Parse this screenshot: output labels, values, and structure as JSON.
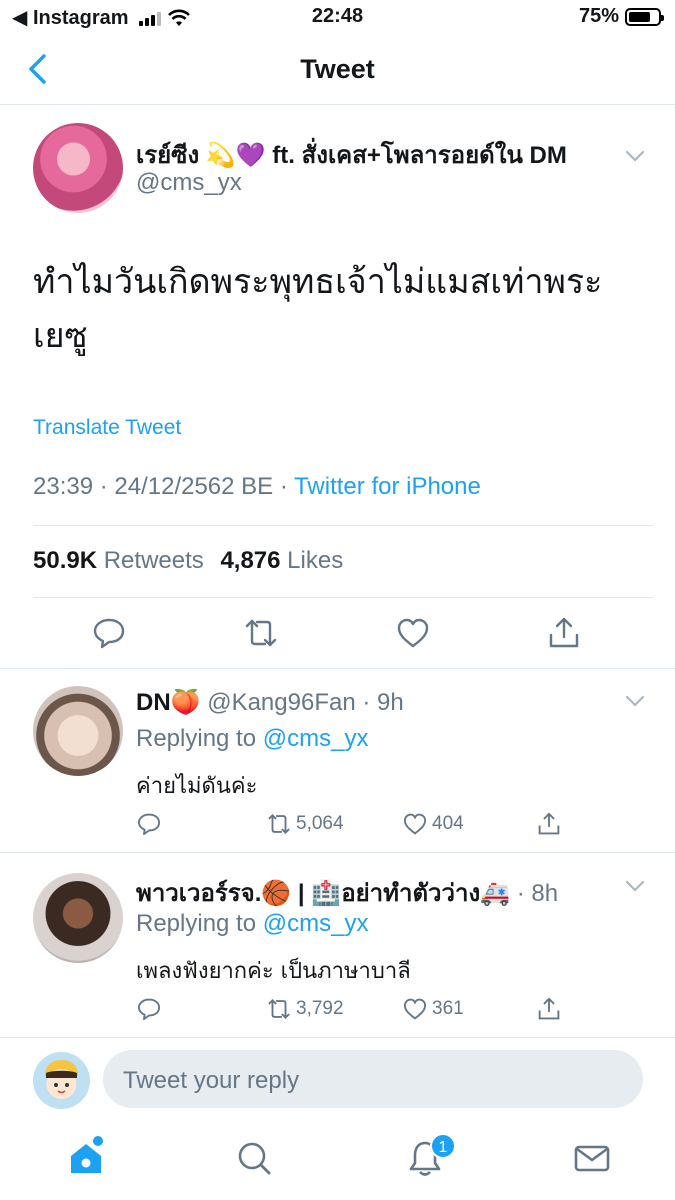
{
  "status": {
    "back_app": "◀ Instagram",
    "time": "22:48",
    "battery": "75%",
    "battery_fraction": 0.75
  },
  "nav": {
    "title": "Tweet"
  },
  "tweet": {
    "name": "เรย์ซีง 💫💜 ft. สั่งเคส+โพลารอยด์ใน DM",
    "handle": "@cms_yx",
    "text": "ทำไมวันเกิดพระพุทธเจ้าไม่แมสเท่าพระเยซู",
    "translate": "Translate Tweet",
    "time": "23:39 · 24/12/2562 BE · ",
    "source": "Twitter for iPhone",
    "retweets": "50.9K",
    "retweets_label": "Retweets",
    "likes": "4,876",
    "likes_label": "Likes"
  },
  "replies": [
    {
      "name": "DN🍑",
      "meta": " @Kang96Fan · 9h",
      "replying_prefix": "Replying to ",
      "replying_to": "@cms_yx",
      "text": "ค่ายไม่ดันค่ะ",
      "retweets": "5,064",
      "likes": "404"
    },
    {
      "name": "พาวเวอร์รจ.🏀 | 🏥อย่าทำตัวว่าง🚑",
      "meta": " · 8h",
      "replying_prefix": "Replying to ",
      "replying_to": "@cms_yx",
      "text": "เพลงฟังยากค่ะ เป็นภาษาบาลี",
      "retweets": "3,792",
      "likes": "361"
    }
  ],
  "compose": {
    "placeholder": "Tweet your reply"
  },
  "tabbar": {
    "notification_badge": "1"
  },
  "colors": {
    "accent": "#1da1f2",
    "secondary_text": "#657786",
    "divider": "#e1e8ed"
  }
}
